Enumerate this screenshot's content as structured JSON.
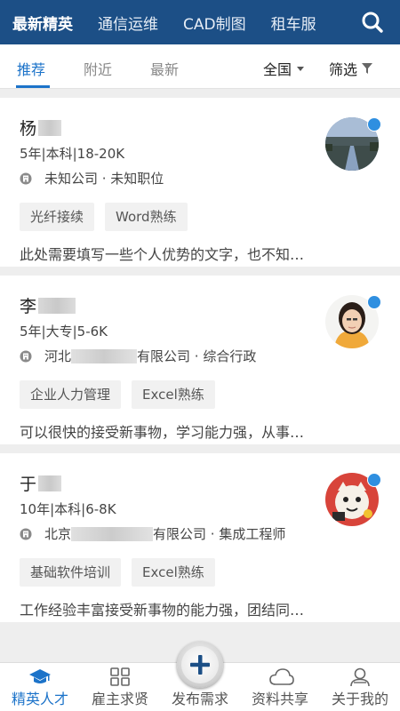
{
  "top_categories": [
    "最新精英",
    "通信运维",
    "CAD制图",
    "租车服"
  ],
  "sub_tabs": [
    "推荐",
    "附近",
    "最新"
  ],
  "region": "全国",
  "filter": "筛选",
  "cards": [
    {
      "name": "杨",
      "meta": "5年|本科|18-20K",
      "company_prefix": "",
      "company": "未知公司 · 未知职位",
      "tags": [
        "光纤接续",
        "Word熟练"
      ],
      "desc": "此处需要填写一些个人优势的文字，也不知…"
    },
    {
      "name": "李",
      "meta": "5年|大专|5-6K",
      "company_prefix": "河北",
      "company": "有限公司 · 综合行政",
      "tags": [
        "企业人力管理",
        "Excel熟练"
      ],
      "desc": "可以很快的接受新事物，学习能力强，从事…"
    },
    {
      "name": "于",
      "meta": "10年|本科|6-8K",
      "company_prefix": "北京",
      "company": "有限公司 · 集成工程师",
      "tags": [
        "基础软件培训",
        "Excel熟练"
      ],
      "desc": "工作经验丰富接受新事物的能力强，团结同…"
    }
  ],
  "bottom_nav": [
    "精英人才",
    "雇主求贤",
    "发布需求",
    "资料共享",
    "关于我的"
  ],
  "colors": {
    "header_bg": "#1c4f86",
    "accent": "#1c73c9",
    "gender_male": "#2f8fe0"
  }
}
